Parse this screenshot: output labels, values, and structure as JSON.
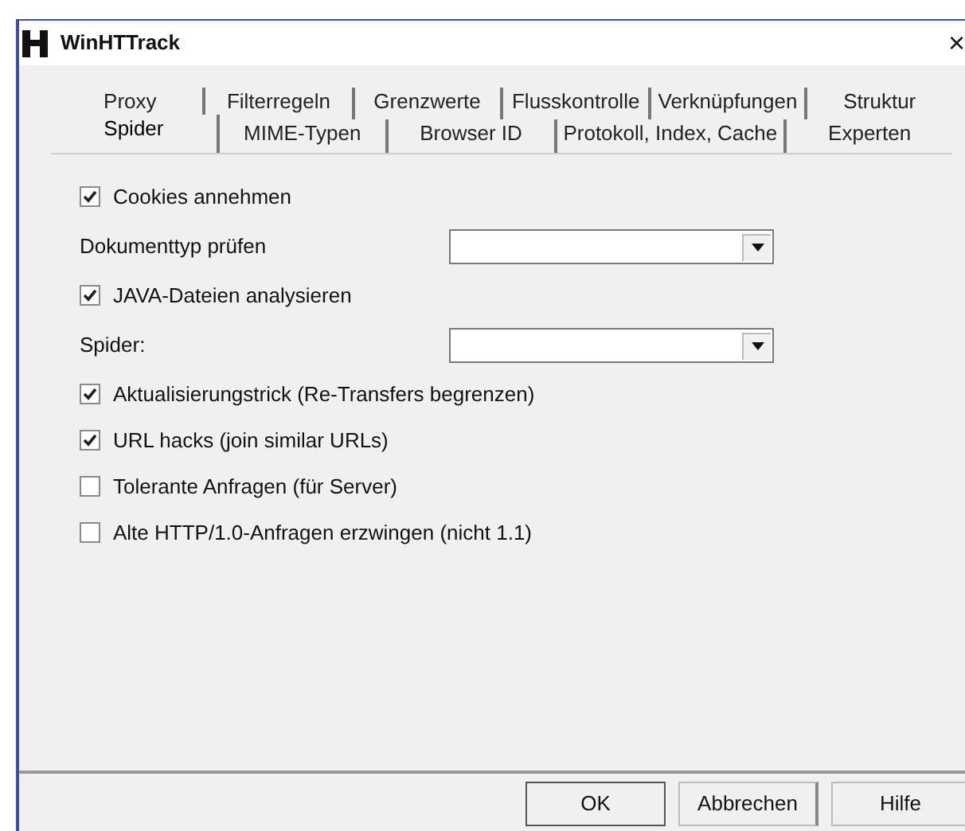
{
  "window": {
    "title": "WinHTTrack",
    "close": "×"
  },
  "tab_rows": [
    [
      {
        "label": "Proxy",
        "selected": false
      },
      {
        "label": "Filterregeln",
        "selected": false
      },
      {
        "label": "Grenzwerte",
        "selected": false
      },
      {
        "label": "Flusskontrolle",
        "selected": false
      },
      {
        "label": "Verknüpfungen",
        "selected": false
      },
      {
        "label": "Struktur",
        "selected": false
      }
    ],
    [
      {
        "label": "Spider",
        "selected": true
      },
      {
        "label": "MIME-Typen",
        "selected": false
      },
      {
        "label": "Browser ID",
        "selected": false
      },
      {
        "label": "Protokoll, Index, Cache",
        "selected": false
      },
      {
        "label": "Experten",
        "selected": false
      }
    ]
  ],
  "options": [
    {
      "kind": "checkbox",
      "label": "Cookies annehmen",
      "checked": true
    },
    {
      "kind": "dropdown",
      "label": "Dokumenttyp prüfen"
    },
    {
      "kind": "checkbox",
      "label": "JAVA-Dateien analysieren",
      "checked": true
    },
    {
      "kind": "dropdown",
      "label": "Spider:"
    },
    {
      "kind": "checkbox",
      "label": "Aktualisierungstrick (Re-Transfers begrenzen)",
      "checked": true
    },
    {
      "kind": "checkbox",
      "label": "URL hacks (join similar URLs)",
      "checked": true
    },
    {
      "kind": "checkbox",
      "label": "Tolerante Anfragen (für Server)",
      "checked": false
    },
    {
      "kind": "checkbox",
      "label": "Alte HTTP/1.0-Anfragen erzwingen (nicht 1.1)",
      "checked": false
    }
  ],
  "buttons": [
    {
      "label": "OK",
      "default": true
    },
    {
      "label": "Abbrechen",
      "default": false
    },
    {
      "label": "Hilfe",
      "default": false
    }
  ]
}
